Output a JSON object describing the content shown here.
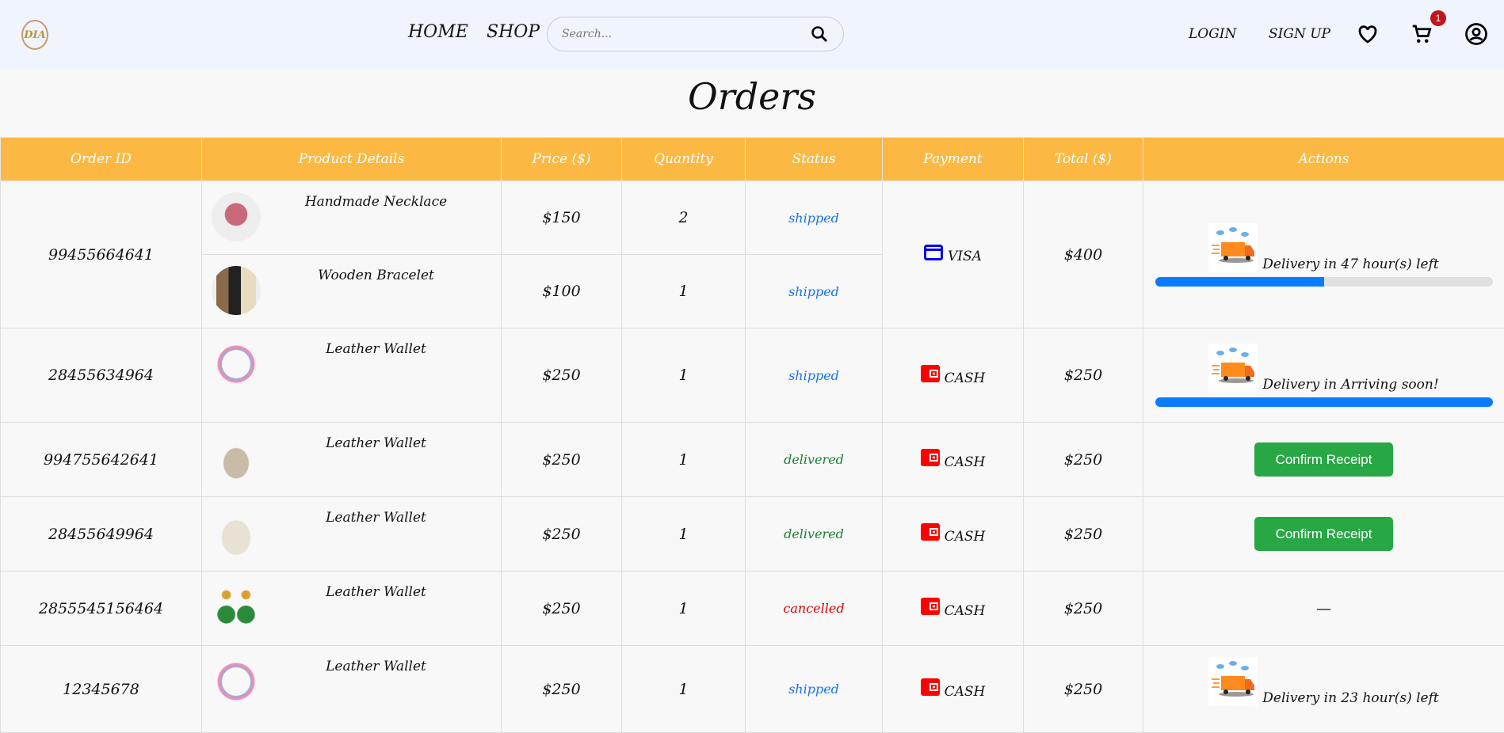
{
  "nav": {
    "logo": "DIA",
    "home": "HOME",
    "shop": "SHOP",
    "search_placeholder": "Search...",
    "login": "LOGIN",
    "signup": "SIGN UP",
    "cart_count": "1"
  },
  "title": "Orders",
  "columns": [
    "Order ID",
    "Product Details",
    "Price ($)",
    "Quantity",
    "Status",
    "Payment",
    "Total ($)",
    "Actions"
  ],
  "colors": {
    "accent": "#fbb943",
    "shipped": "#1a73e8",
    "delivered": "#1e7e34",
    "cancelled": "#e00000",
    "progress": "#0a7bff",
    "confirm": "#28a745"
  },
  "orders": [
    {
      "id": "99455664641",
      "items": [
        {
          "name": "Handmade Necklace",
          "price": "$150",
          "qty": "2",
          "status": "shipped",
          "thumb": "pink-bag"
        },
        {
          "name": "Wooden Bracelet",
          "price": "$100",
          "qty": "1",
          "status": "shipped",
          "thumb": "hobo-bags"
        }
      ],
      "payment": "VISA",
      "pay_icon": "credit-card-icon",
      "total": "$400",
      "action": {
        "type": "delivery",
        "text": "Delivery in 47 hour(s) left",
        "progress": 0.5
      }
    },
    {
      "id": "28455634964",
      "items": [
        {
          "name": "Leather Wallet",
          "price": "$250",
          "qty": "1",
          "status": "shipped",
          "thumb": "bracelet"
        }
      ],
      "payment": "CASH",
      "pay_icon": "wallet-icon",
      "total": "$250",
      "action": {
        "type": "delivery",
        "text": "Delivery in Arriving soon!",
        "progress": 1.0
      }
    },
    {
      "id": "994755642641",
      "items": [
        {
          "name": "Leather Wallet",
          "price": "$250",
          "qty": "1",
          "status": "delivered",
          "thumb": "crochet-bag"
        }
      ],
      "payment": "CASH",
      "pay_icon": "wallet-icon",
      "total": "$250",
      "action": {
        "type": "button",
        "text": "Confirm Receipt"
      }
    },
    {
      "id": "28455649964",
      "items": [
        {
          "name": "Leather Wallet",
          "price": "$250",
          "qty": "1",
          "status": "delivered",
          "thumb": "white-bag"
        }
      ],
      "payment": "CASH",
      "pay_icon": "wallet-icon",
      "total": "$250",
      "action": {
        "type": "button",
        "text": "Confirm Receipt"
      }
    },
    {
      "id": "2855545156464",
      "items": [
        {
          "name": "Leather Wallet",
          "price": "$250",
          "qty": "1",
          "status": "cancelled",
          "thumb": "earrings"
        }
      ],
      "payment": "CASH",
      "pay_icon": "wallet-icon",
      "total": "$250",
      "action": {
        "type": "none",
        "text": "—"
      }
    },
    {
      "id": "12345678",
      "items": [
        {
          "name": "Leather Wallet",
          "price": "$250",
          "qty": "1",
          "status": "shipped",
          "thumb": "bracelet"
        }
      ],
      "payment": "CASH",
      "pay_icon": "wallet-icon",
      "total": "$250",
      "action": {
        "type": "delivery",
        "text": "Delivery in 23 hour(s) left"
      }
    }
  ]
}
